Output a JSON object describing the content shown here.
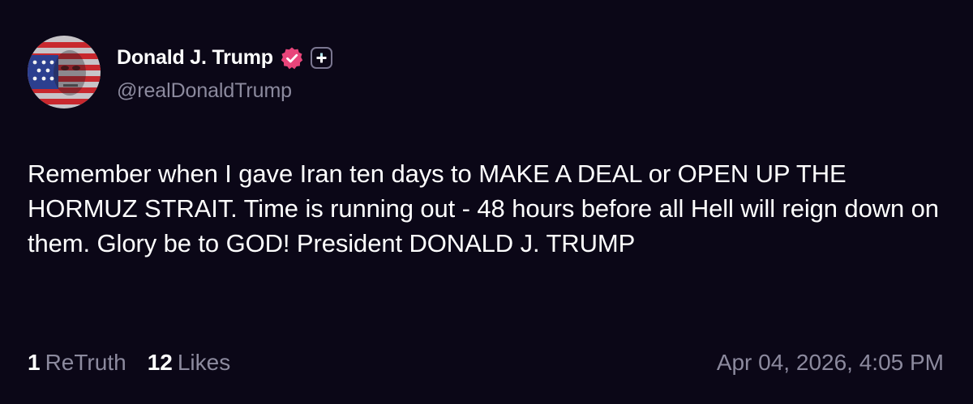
{
  "author": {
    "display_name": "Donald J. Trump",
    "handle": "@realDonaldTrump",
    "avatar_icon": "flag-portrait-avatar",
    "verified_icon": "verified-badge-icon",
    "extra_icon": "plus-badge-icon"
  },
  "post": {
    "text": "Remember when I gave Iran ten days to MAKE A DEAL or OPEN UP THE HORMUZ STRAIT. Time is running out - 48 hours before all Hell will reign down on them. Glory be to GOD! President DONALD J. TRUMP"
  },
  "stats": {
    "retruths_count": "1",
    "retruths_label": "ReTruth",
    "likes_count": "12",
    "likes_label": "Likes"
  },
  "timestamp": "Apr 04, 2026, 4:05 PM",
  "colors": {
    "background": "#0b0717",
    "text": "#ffffff",
    "muted": "#8c8a9e",
    "verified": "#e8457a"
  }
}
